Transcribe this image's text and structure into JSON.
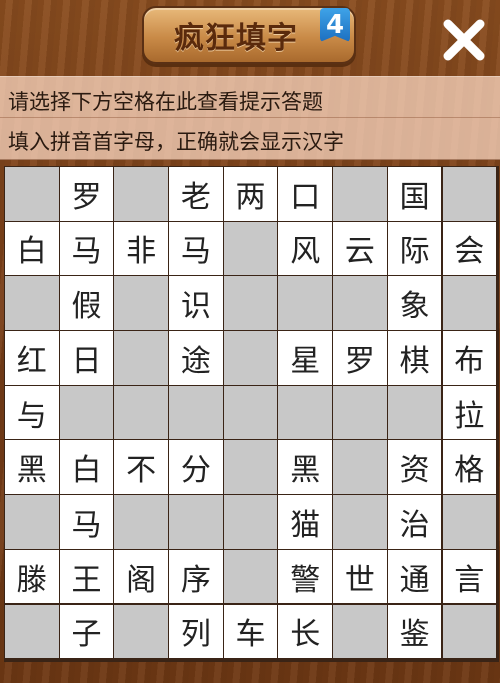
{
  "header": {
    "title": "疯狂填字",
    "level": "4",
    "close_icon": "close-x-icon"
  },
  "hints": {
    "line1": "请选择下方空格在此查看提示答题",
    "line2": "填入拼音首字母，正确就会显示汉字"
  },
  "colors": {
    "blank_cell": "#c8c8c8",
    "filled_cell": "#ffffff",
    "level_badge": "#2a86d8"
  },
  "grid": {
    "rows": [
      [
        "",
        "罗",
        "",
        "老",
        "两",
        "口",
        "",
        "国",
        ""
      ],
      [
        "白",
        "马",
        "非",
        "马",
        "",
        "风",
        "云",
        "际",
        "会"
      ],
      [
        "",
        "假",
        "",
        "识",
        "",
        "",
        "",
        "象",
        ""
      ],
      [
        "红",
        "日",
        "",
        "途",
        "",
        "星",
        "罗",
        "棋",
        "布"
      ],
      [
        "与",
        "",
        "",
        "",
        "",
        "",
        "",
        "",
        "拉"
      ],
      [
        "黑",
        "白",
        "不",
        "分",
        "",
        "黑",
        "",
        "资",
        "格"
      ],
      [
        "",
        "马",
        "",
        "",
        "",
        "猫",
        "",
        "治",
        ""
      ],
      [
        "滕",
        "王",
        "阁",
        "序",
        "",
        "警",
        "世",
        "通",
        "言"
      ],
      [
        "",
        "子",
        "",
        "列",
        "车",
        "长",
        "",
        "鉴",
        ""
      ]
    ],
    "active": [
      [
        0,
        1,
        0,
        1,
        1,
        1,
        0,
        1,
        0
      ],
      [
        1,
        1,
        1,
        1,
        0,
        1,
        1,
        1,
        1
      ],
      [
        0,
        1,
        0,
        1,
        0,
        0,
        0,
        1,
        0
      ],
      [
        1,
        1,
        0,
        1,
        0,
        1,
        1,
        1,
        1
      ],
      [
        1,
        0,
        0,
        0,
        0,
        0,
        0,
        0,
        1
      ],
      [
        1,
        1,
        1,
        1,
        0,
        1,
        0,
        1,
        1
      ],
      [
        0,
        1,
        0,
        0,
        0,
        1,
        0,
        1,
        0
      ],
      [
        1,
        1,
        1,
        1,
        0,
        1,
        1,
        1,
        1
      ],
      [
        0,
        1,
        0,
        1,
        1,
        1,
        0,
        1,
        0
      ]
    ]
  }
}
